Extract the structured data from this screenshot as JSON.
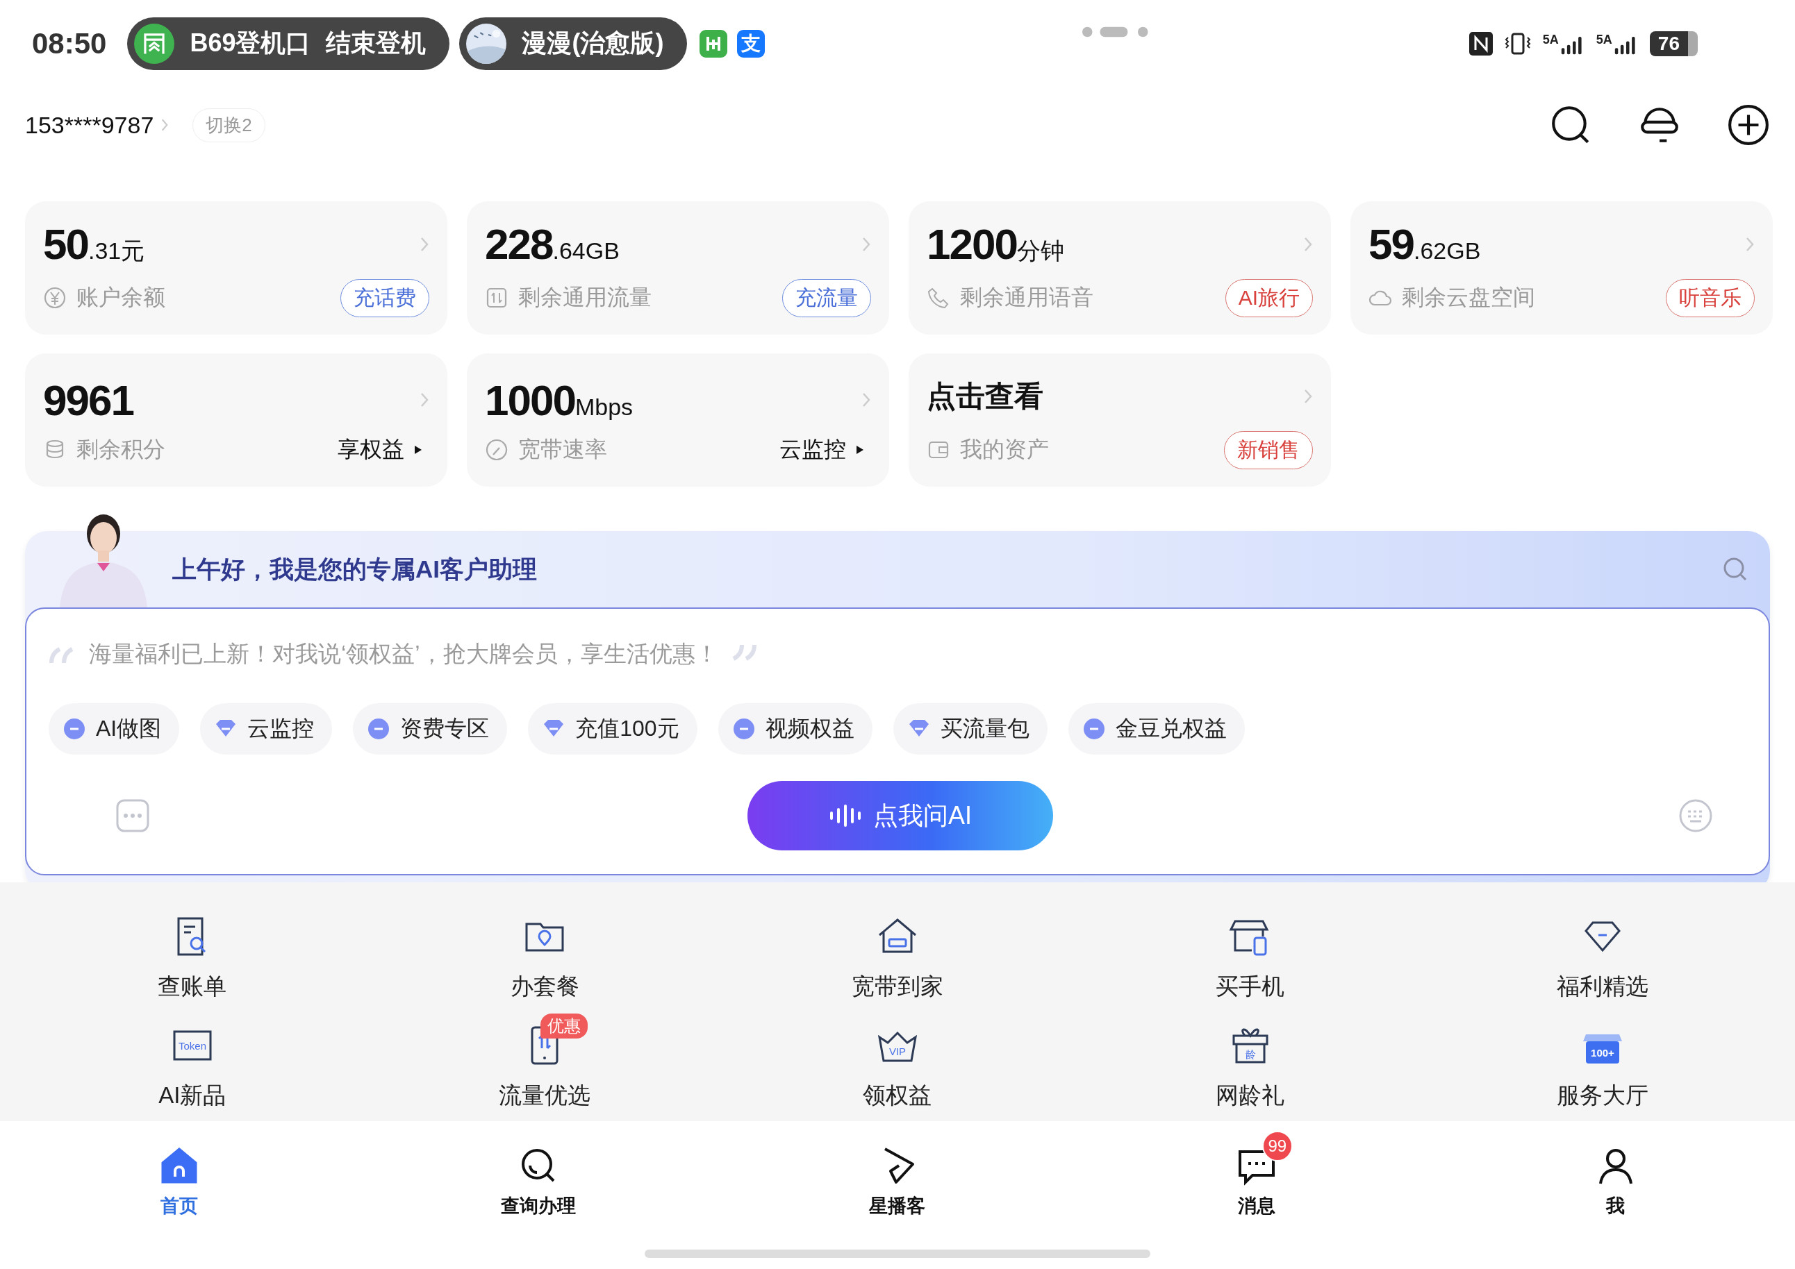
{
  "status_bar": {
    "time": "08:50",
    "activities": [
      {
        "texts": [
          "B69登机口",
          "结束登机"
        ]
      },
      {
        "texts": [
          "漫漫(治愈版)"
        ]
      }
    ],
    "alipay_glyph": "支",
    "network_labels": [
      "5A",
      "5A"
    ],
    "battery": "76"
  },
  "account": {
    "phone": "153****9787",
    "switch_label": "切换2"
  },
  "cards": [
    {
      "kind": "number",
      "value": "50",
      "suffix": ".31元",
      "label": "账户余额",
      "action": {
        "kind": "blue",
        "text": "充话费"
      }
    },
    {
      "kind": "number",
      "value": "228",
      "suffix": ".64GB",
      "label": "剩余通用流量",
      "action": {
        "kind": "blue",
        "text": "充流量"
      }
    },
    {
      "kind": "number",
      "value": "1200",
      "suffix": "分钟",
      "label": "剩余通用语音",
      "action": {
        "kind": "red",
        "text": "AI旅行"
      }
    },
    {
      "kind": "number",
      "value": "59",
      "suffix": ".62GB",
      "label": "剩余云盘空间",
      "action": {
        "kind": "red",
        "text": "听音乐"
      }
    },
    {
      "kind": "number",
      "value": "9961",
      "label": "剩余积分",
      "action": {
        "kind": "arrow",
        "text": "享权益"
      }
    },
    {
      "kind": "number",
      "value": "1000",
      "suffix": "Mbps",
      "label": "宽带速率",
      "action": {
        "kind": "arrow",
        "text": "云监控"
      }
    },
    {
      "kind": "text",
      "value": "点击查看",
      "label": "我的资产",
      "action": {
        "kind": "red",
        "text": "新销售"
      }
    }
  ],
  "assistant": {
    "greeting": "上午好，我是您的专属AI客户助理",
    "prompt": "海量福利已上新！对我说‘领权益’，抢大牌会员，享生活优惠！",
    "chips": [
      "AI做图",
      "云监控",
      "资费专区",
      "充值100元",
      "视频权益",
      "买流量包",
      "金豆兑权益"
    ],
    "ask_button": "点我问AI"
  },
  "services": [
    {
      "label": "查账单"
    },
    {
      "label": "办套餐"
    },
    {
      "label": "宽带到家"
    },
    {
      "label": "买手机"
    },
    {
      "label": "福利精选"
    },
    {
      "label": "AI新品",
      "icon_text": "Token"
    },
    {
      "label": "流量优选",
      "badge": "优惠"
    },
    {
      "label": "领权益",
      "icon_text": "VIP"
    },
    {
      "label": "网龄礼",
      "icon_text": "龄"
    },
    {
      "label": "服务大厅",
      "icon_text": "100+"
    }
  ],
  "nav": [
    {
      "label": "首页",
      "selected": true
    },
    {
      "label": "查询办理",
      "selected": false
    },
    {
      "label": "星播客",
      "selected": false
    },
    {
      "label": "消息",
      "selected": false,
      "badge": "99"
    },
    {
      "label": "我",
      "selected": false
    }
  ]
}
